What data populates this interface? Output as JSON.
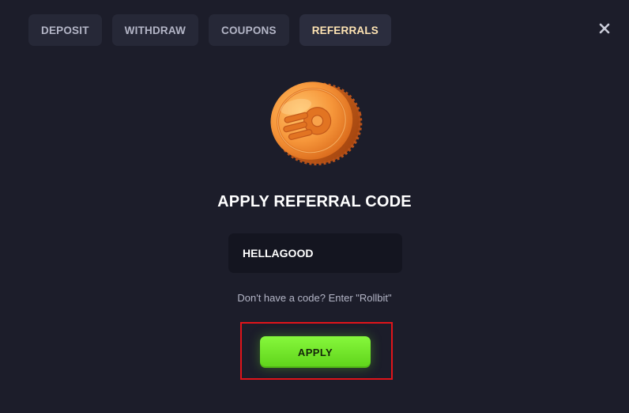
{
  "tabs": [
    {
      "label": "DEPOSIT"
    },
    {
      "label": "WITHDRAW"
    },
    {
      "label": "COUPONS"
    },
    {
      "label": "REFERRALS",
      "active": true
    }
  ],
  "close_icon": "close-icon",
  "coin_icon": "coin-icon",
  "title": "APPLY REFERRAL CODE",
  "code_input": {
    "value": "HELLAGOOD"
  },
  "hint": "Don't have a code? Enter \"Rollbit\"",
  "apply_button": {
    "label": "APPLY"
  },
  "colors": {
    "background": "#1c1d2a",
    "tab_bg": "#262837",
    "tab_text": "#b3b5c6",
    "active_tab_text": "#ffe4b3",
    "input_bg": "#141520",
    "button_green": "#72e62b",
    "highlight_red": "#e0141a"
  }
}
